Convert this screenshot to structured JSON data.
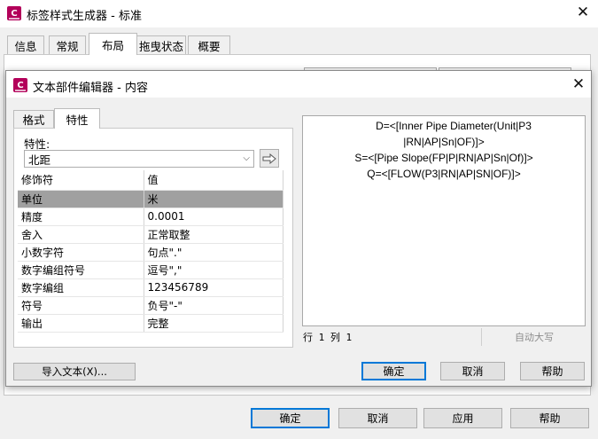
{
  "outer": {
    "title": "标签样式生成器 - 标准",
    "tabs": [
      {
        "label": "信息"
      },
      {
        "label": "常规"
      },
      {
        "label": "布局",
        "active": true
      },
      {
        "label": "拖曳状态"
      },
      {
        "label": "概要"
      }
    ],
    "buttons": {
      "ok": "确定",
      "cancel": "取消",
      "apply": "应用",
      "help": "帮助"
    }
  },
  "inner": {
    "title": "文本部件编辑器 - 内容",
    "tabs": [
      {
        "label": "格式"
      },
      {
        "label": "特性",
        "active": true
      }
    ],
    "property_label": "特性:",
    "property_value": "北距",
    "table": {
      "headers": {
        "modifier": "修饰符",
        "value": "值"
      },
      "rows": [
        {
          "modifier": "单位",
          "value": "米",
          "selected": true
        },
        {
          "modifier": "精度",
          "value": "0.0001"
        },
        {
          "modifier": "舍入",
          "value": "正常取整"
        },
        {
          "modifier": "小数字符",
          "value": "句点\".\""
        },
        {
          "modifier": "数字编组符号",
          "value": "逗号\",\""
        },
        {
          "modifier": "数字编组",
          "value": "123456789"
        },
        {
          "modifier": "符号",
          "value": "负号\"-\""
        },
        {
          "modifier": "输出",
          "value": "完整"
        }
      ]
    },
    "editor_lines": [
      "D=<[Inner Pipe Diameter(Unit|P3",
      "|RN|AP|Sn|OF)]>",
      "S=<[Pipe Slope(FP|P|RN|AP|Sn|Of)]>",
      "Q=<[FLOW(P3|RN|AP|SN|OF)]>"
    ],
    "status": {
      "position": "行 1 列 1",
      "autocaps": "自动大写"
    },
    "buttons": {
      "import": "导入文本(X)...",
      "ok": "确定",
      "cancel": "取消",
      "help": "帮助"
    }
  },
  "colors": {
    "app_icon": "#b3005a",
    "default_button_border": "#0078d7",
    "selected_row": "#a0a0a0"
  }
}
